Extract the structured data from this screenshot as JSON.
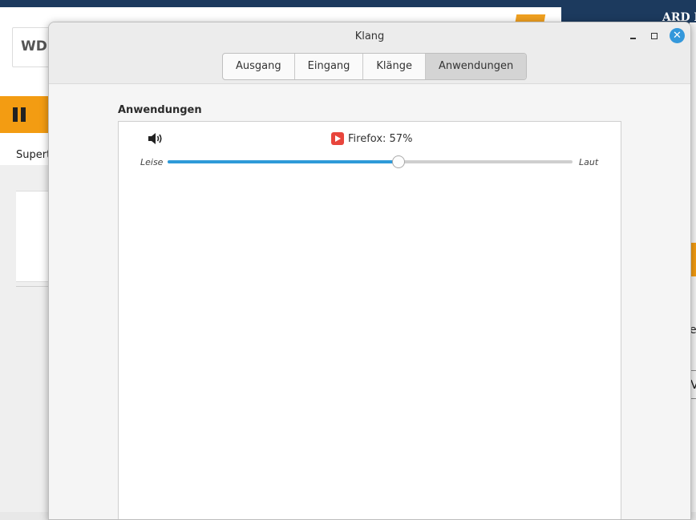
{
  "background_page": {
    "logo_text": "WDR",
    "subtitle_text": "Supert"
  },
  "right_panel": {
    "title": "ARD M",
    "char_1": "e",
    "char_2": "V"
  },
  "dialog": {
    "title": "Klang",
    "tabs": [
      {
        "label": "Ausgang",
        "active": false
      },
      {
        "label": "Eingang",
        "active": false
      },
      {
        "label": "Klänge",
        "active": false
      },
      {
        "label": "Anwendungen",
        "active": true
      }
    ],
    "section_label": "Anwendungen",
    "application": {
      "label": "Firefox: 57%",
      "icon": "firefox-play-icon",
      "volume_fraction": 0.57
    },
    "slider_min_label": "Leise",
    "slider_max_label": "Laut"
  },
  "colors": {
    "accent": "#2e9ad8",
    "close_button": "#3498db",
    "orange": "#f39c12",
    "navy": "#1c3a5e",
    "app_icon": "#e8453c"
  }
}
